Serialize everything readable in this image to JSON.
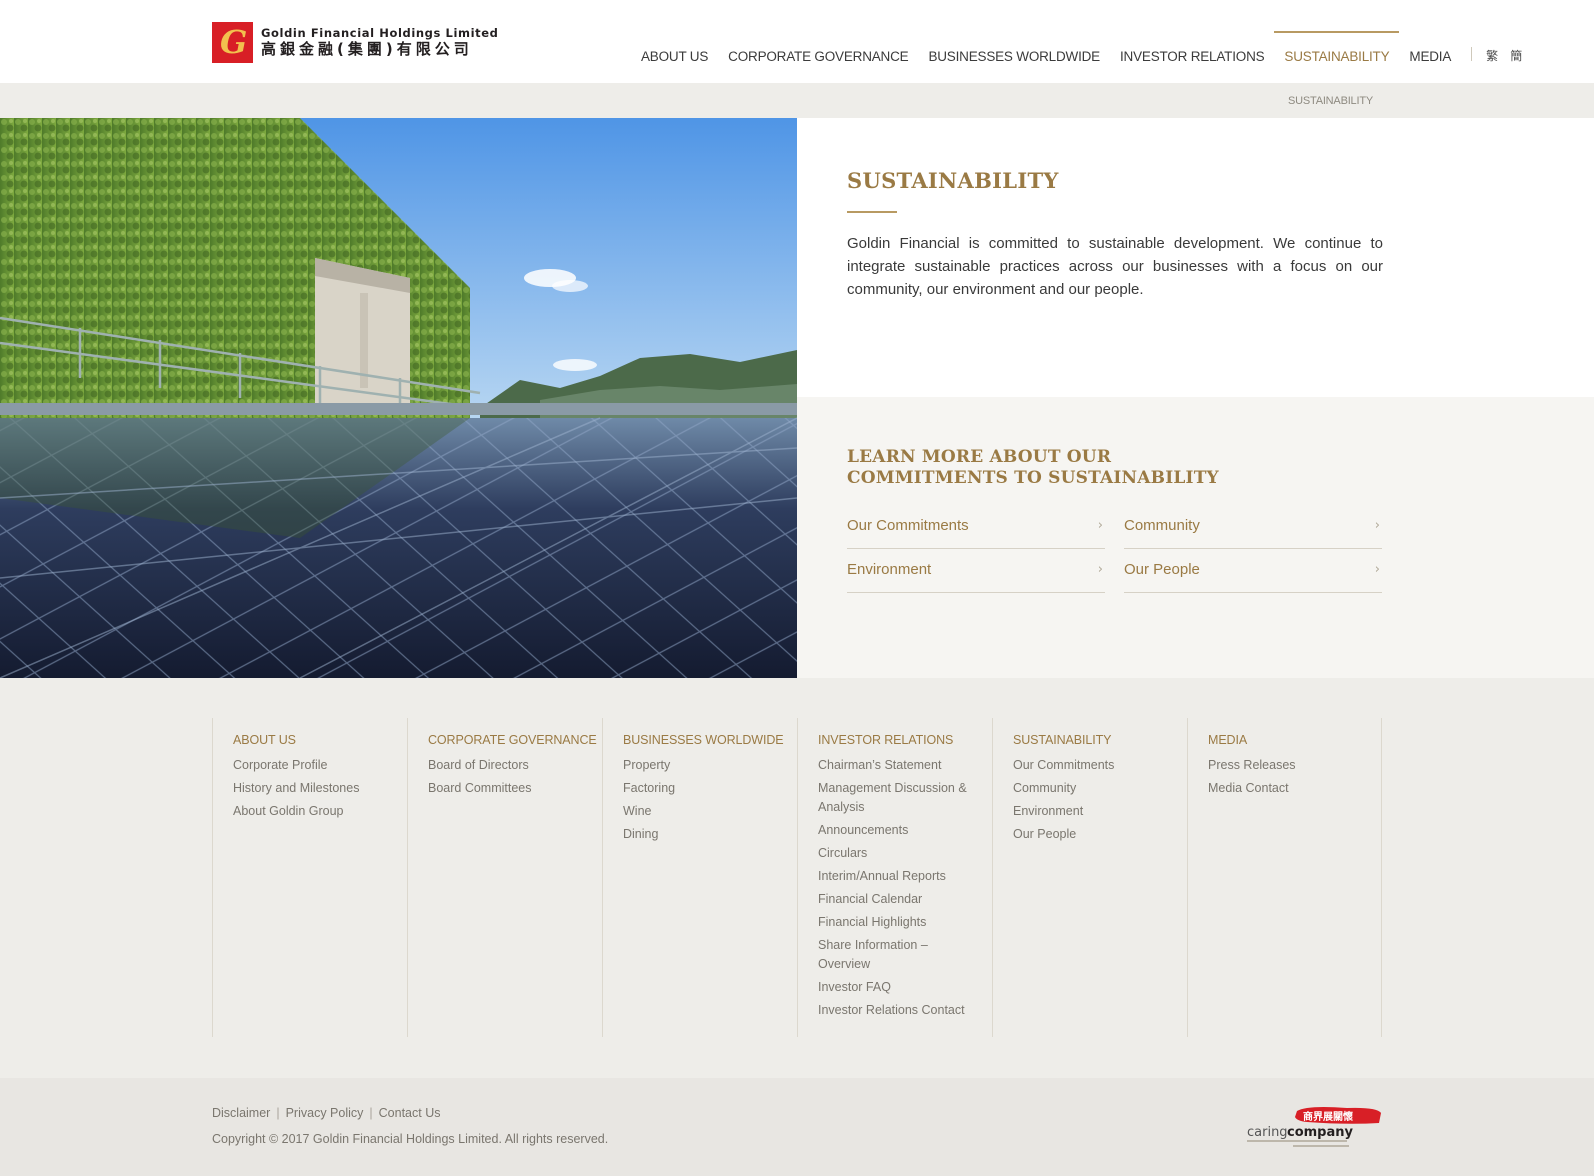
{
  "header": {
    "logo_en": "Goldin Financial Holdings Limited",
    "logo_zh": "高銀金融(集團)有限公司",
    "nav": [
      {
        "label": "ABOUT US",
        "active": false
      },
      {
        "label": "CORPORATE GOVERNANCE",
        "active": false
      },
      {
        "label": "BUSINESSES WORLDWIDE",
        "active": false
      },
      {
        "label": "INVESTOR RELATIONS",
        "active": false
      },
      {
        "label": "SUSTAINABILITY",
        "active": true
      },
      {
        "label": "MEDIA",
        "active": false
      }
    ],
    "lang_tc": "繁",
    "lang_sc": "簡"
  },
  "breadcrumb": "SUSTAINABILITY",
  "intro": {
    "title": "SUSTAINABILITY",
    "text": "Goldin Financial is committed to sustainable development. We continue to integrate sustainable practices across our businesses with a focus on our community, our environment and our people."
  },
  "learn_more": {
    "title": "LEARN MORE ABOUT OUR COMMITMENTS TO SUSTAINABILITY",
    "links": [
      "Our Commitments",
      "Community",
      "Environment",
      "Our People"
    ]
  },
  "footer": {
    "columns": [
      {
        "title": "ABOUT US",
        "items": [
          "Corporate Profile",
          "History and Milestones",
          "About Goldin Group"
        ]
      },
      {
        "title": "CORPORATE GOVERNANCE",
        "items": [
          "Board of Directors",
          "Board Committees"
        ]
      },
      {
        "title": "BUSINESSES WORLDWIDE",
        "items": [
          "Property",
          "Factoring",
          "Wine",
          "Dining"
        ]
      },
      {
        "title": "INVESTOR RELATIONS",
        "items": [
          "Chairman’s Statement",
          "Management Discussion & Analysis",
          "Announcements",
          "Circulars",
          "Interim/Annual Reports",
          "Financial Calendar",
          "Financial Highlights",
          "Share Information – Overview",
          "Investor FAQ",
          "Investor Relations Contact"
        ]
      },
      {
        "title": "SUSTAINABILITY",
        "items": [
          "Our Commitments",
          "Community",
          "Environment",
          "Our People"
        ]
      },
      {
        "title": "MEDIA",
        "items": [
          "Press Releases",
          "Media Contact"
        ]
      }
    ]
  },
  "bottom": {
    "links": [
      "Disclaimer",
      "Privacy Policy",
      "Contact Us"
    ],
    "copyright": "Copyright © 2017 Goldin Financial Holdings Limited. All rights reserved.",
    "caring_zh": "商界展關懷",
    "caring_caring": "caring",
    "caring_company": "company"
  },
  "colors": {
    "accent_gold": "#9a7a44",
    "logo_red": "#d81f26",
    "footer_bg": "#eeede9"
  }
}
